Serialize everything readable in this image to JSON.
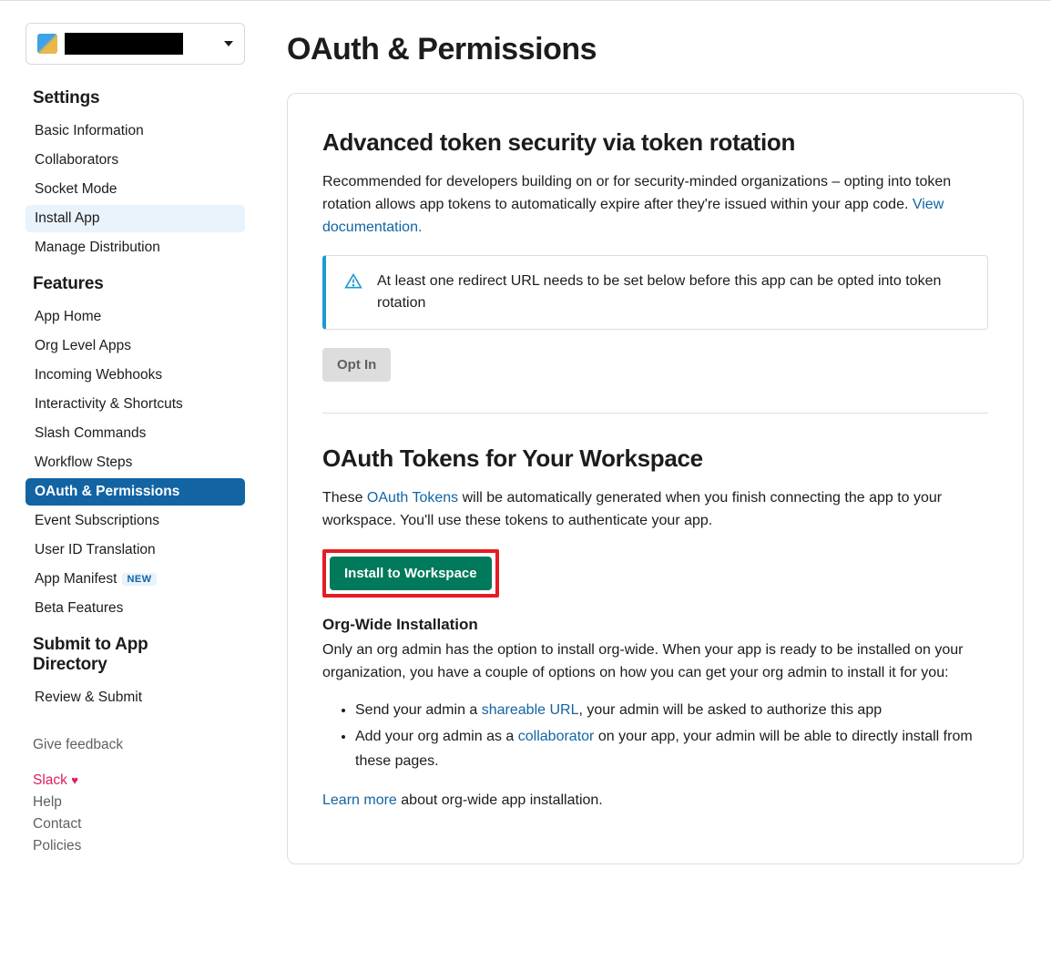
{
  "sidebar": {
    "section_settings": "Settings",
    "settings_items": [
      {
        "label": "Basic Information"
      },
      {
        "label": "Collaborators"
      },
      {
        "label": "Socket Mode"
      },
      {
        "label": "Install App",
        "highlighted": true
      },
      {
        "label": "Manage Distribution"
      }
    ],
    "section_features": "Features",
    "features_items": [
      {
        "label": "App Home"
      },
      {
        "label": "Org Level Apps"
      },
      {
        "label": "Incoming Webhooks"
      },
      {
        "label": "Interactivity & Shortcuts"
      },
      {
        "label": "Slash Commands"
      },
      {
        "label": "Workflow Steps"
      },
      {
        "label": "OAuth & Permissions",
        "active": true
      },
      {
        "label": "Event Subscriptions"
      },
      {
        "label": "User ID Translation"
      },
      {
        "label": "App Manifest",
        "badge": "NEW"
      },
      {
        "label": "Beta Features"
      }
    ],
    "section_submit": "Submit to App Directory",
    "submit_items": [
      {
        "label": "Review & Submit"
      }
    ],
    "feedback": "Give feedback",
    "footer": {
      "slack": "Slack",
      "help": "Help",
      "contact": "Contact",
      "policies": "Policies"
    }
  },
  "main": {
    "page_title": "OAuth & Permissions",
    "token_rotation": {
      "title": "Advanced token security via token rotation",
      "desc": "Recommended for developers building on or for security-minded organizations – opting into token rotation allows app tokens to automatically expire after they're issued within your app code. ",
      "doc_link": "View documentation.",
      "alert": "At least one redirect URL needs to be set below before this app can be opted into token rotation",
      "opt_in_btn": "Opt In"
    },
    "oauth_tokens": {
      "title": "OAuth Tokens for Your Workspace",
      "desc_a": "These ",
      "desc_link": "OAuth Tokens",
      "desc_b": " will be automatically generated when you finish connecting the app to your workspace. You'll use these tokens to authenticate your app.",
      "install_btn": "Install to Workspace",
      "org_wide_title": "Org-Wide Installation",
      "org_wide_desc": "Only an org admin has the option to install org-wide. When your app is ready to be installed on your organization, you have a couple of options on how you can get your org admin to install it for you:",
      "bullet1_a": "Send your admin a ",
      "bullet1_link": "shareable URL",
      "bullet1_b": ", your admin will be asked to authorize this app",
      "bullet2_a": "Add your org admin as a ",
      "bullet2_link": "collaborator",
      "bullet2_b": " on your app, your admin will be able to directly install from these pages.",
      "learn_more": "Learn more",
      "learn_more_suffix": " about org-wide app installation."
    }
  }
}
